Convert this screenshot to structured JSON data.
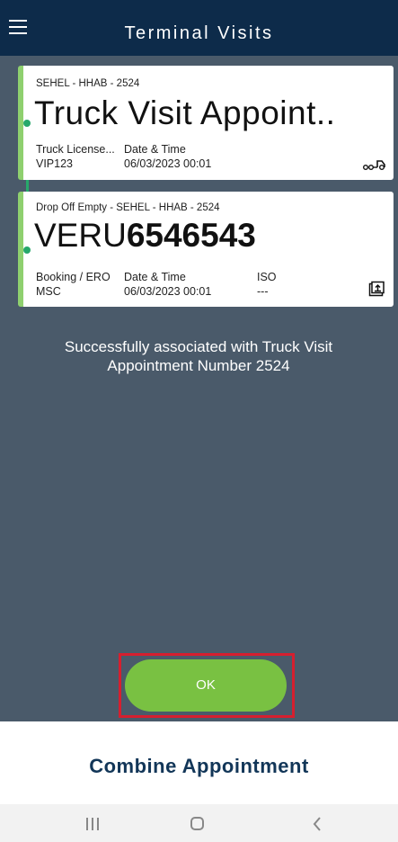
{
  "header": {
    "title": "Terminal Visits",
    "menu_icon": "hamburger-menu-icon"
  },
  "cards": [
    {
      "subtitle": "SEHEL - HHAB - 2524",
      "title": "Truck Visit Appoint..",
      "fields": [
        {
          "label": "Truck License...",
          "value": "VIP123"
        },
        {
          "label": "Date & Time",
          "value": "06/03/2023 00:01"
        }
      ],
      "icon": "truck-icon"
    },
    {
      "subtitle": "Drop Off Empty - SEHEL - HHAB - 2524",
      "title_prefix": "VERU",
      "title_number": "6546543",
      "fields": [
        {
          "label": "Booking / ERO",
          "value": "MSC"
        },
        {
          "label": "Date & Time",
          "value": "06/03/2023 00:01"
        },
        {
          "label": "ISO",
          "value": "---"
        }
      ],
      "icon": "container-icon"
    }
  ],
  "message": "Successfully associated with Truck Visit Appointment Number 2524",
  "ok_button": "OK",
  "bottom_title": "Combine Appointment",
  "colors": {
    "header_bg": "#0d2b4a",
    "content_bg": "#4a5a6a",
    "card_accent": "#8fd06f",
    "timeline": "#27a86b",
    "ok_button": "#79c142",
    "highlight": "#d61f2f",
    "bottom_title": "#123658"
  },
  "system_nav": {
    "recents_icon": "recents-icon",
    "home_icon": "home-icon",
    "back_icon": "back-icon"
  }
}
